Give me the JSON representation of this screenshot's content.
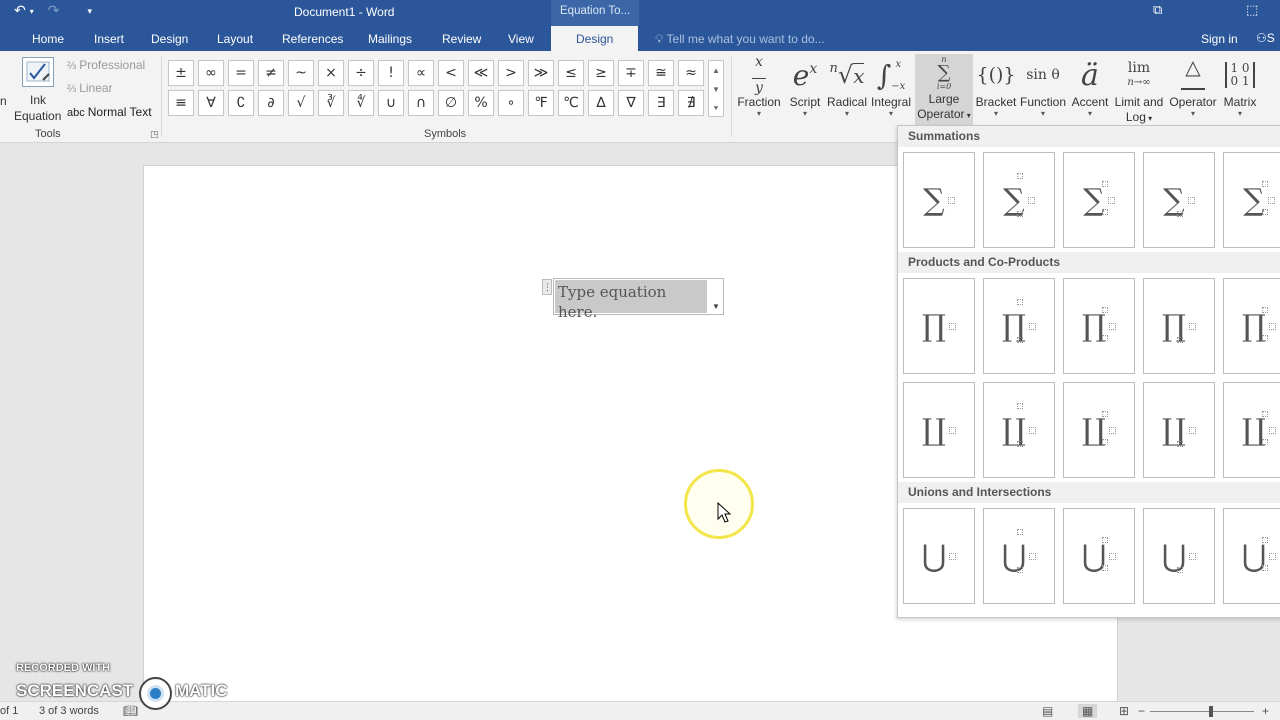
{
  "titlebar": {
    "undo_icon": "↶",
    "redo_icon": "↷",
    "qat_more_icon": "⯆",
    "document_title": "Document1 - Word",
    "context_title": "Equation To...",
    "restore_icon": "⧉",
    "minimize_icon": "⬚"
  },
  "tabs": {
    "home": "Home",
    "insert": "Insert",
    "design": "Design",
    "layout": "Layout",
    "references": "References",
    "mailings": "Mailings",
    "review": "Review",
    "view": "View",
    "eq_design": "Design"
  },
  "tell_me": "Tell me what you want to do...",
  "sign_in": "Sign in",
  "share_cut": "S",
  "tools": {
    "left_cut": "n",
    "ink_label_1": "Ink",
    "ink_label_2": "Equation",
    "professional": "Professional",
    "linear": "Linear",
    "normal_text_prefix": "abc",
    "normal_text": "Normal Text",
    "group_label": "Tools"
  },
  "symbols": {
    "group_label": "Symbols",
    "row1": [
      "±",
      "∞",
      "=",
      "≠",
      "~",
      "×",
      "÷",
      "!",
      "∝",
      "<",
      "≪",
      ">",
      "≫",
      "≤",
      "≥",
      "∓",
      "≅",
      "≈"
    ],
    "row2": [
      "≡",
      "∀",
      "∁",
      "∂",
      "√",
      "∛",
      "∜",
      "∪",
      "∩",
      "∅",
      "%",
      "∘",
      "℉",
      "℃",
      "∆",
      "∇",
      "∃",
      "∄"
    ]
  },
  "structures": {
    "fraction": "Fraction",
    "script": "Script",
    "radical": "Radical",
    "integral": "Integral",
    "large_operator_1": "Large",
    "large_operator_2": "Operator",
    "bracket": "Bracket",
    "function": "Function",
    "accent": "Accent",
    "limit_1": "Limit and",
    "limit_2": "Log",
    "operator": "Operator",
    "matrix": "Matrix"
  },
  "equation": {
    "placeholder": "Type equation here."
  },
  "gallery": {
    "summations": "Summations",
    "products": "Products and Co-Products",
    "unions": "Unions and Intersections",
    "sum_symbol": "∑",
    "prod_symbol": "∏",
    "coprod_symbol": "∐",
    "union_symbol": "⋃"
  },
  "statusbar": {
    "page": "of 1",
    "words": "3 of 3 words"
  },
  "watermark": {
    "line1": "RECORDED WITH",
    "line2a": "SCREENCAST",
    "line2b": "MATIC"
  }
}
